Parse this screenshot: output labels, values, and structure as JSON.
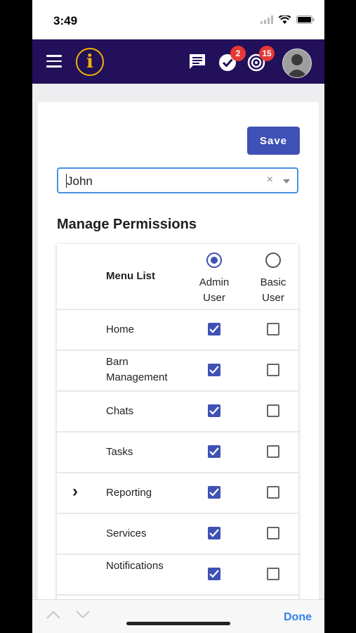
{
  "status_bar": {
    "time": "3:49"
  },
  "app_bar": {
    "logo_letter": "i",
    "tasks_badge": "2",
    "targets_badge": "15"
  },
  "form": {
    "save_label": "Save",
    "user_value": "John",
    "clear_symbol": "×"
  },
  "permissions": {
    "title": "Manage Permissions",
    "header": {
      "menu_list": "Menu List",
      "admin": "Admin User",
      "basic": "Basic User",
      "selected_role": "admin"
    },
    "rows": [
      {
        "label": "Home",
        "expandable": false,
        "admin": true,
        "basic": false
      },
      {
        "label": "Barn Management",
        "expandable": false,
        "admin": true,
        "basic": false
      },
      {
        "label": "Chats",
        "expandable": false,
        "admin": true,
        "basic": false
      },
      {
        "label": "Tasks",
        "expandable": false,
        "admin": true,
        "basic": false
      },
      {
        "label": "Reporting",
        "expandable": true,
        "admin": true,
        "basic": false
      },
      {
        "label": "Services",
        "expandable": false,
        "admin": true,
        "basic": false
      },
      {
        "label": "Notifications",
        "expandable": false,
        "admin": true,
        "basic": false
      }
    ]
  },
  "keyboard_bar": {
    "done_label": "Done"
  },
  "colors": {
    "app_bar": "#23105a",
    "accent": "#3f51b5",
    "badge": "#e53935",
    "logo": "#f0b400",
    "done": "#2f80ed"
  }
}
